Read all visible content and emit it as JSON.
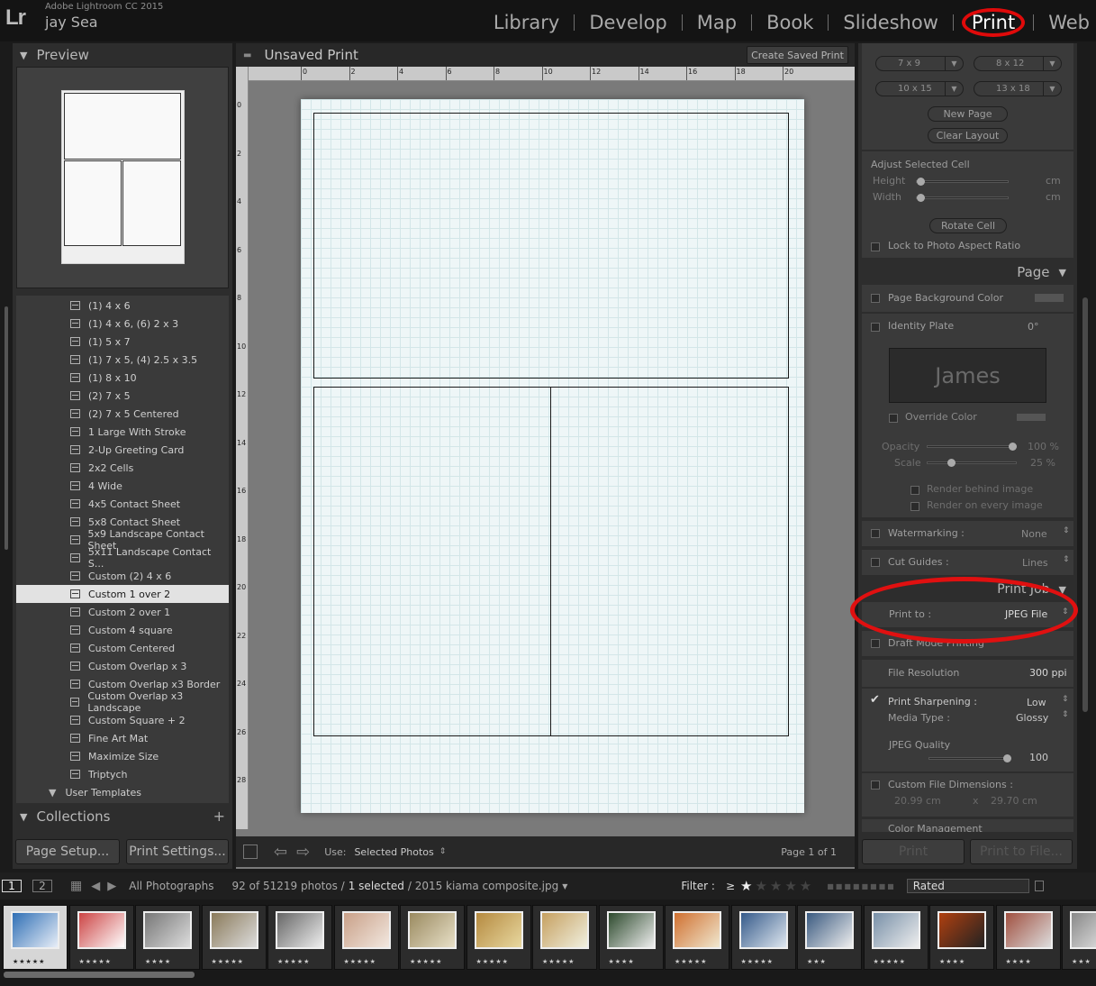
{
  "app": {
    "name": "Adobe Lightroom CC 2015",
    "user": "jay Sea",
    "logo": "Lr"
  },
  "modules": [
    "Library",
    "Develop",
    "Map",
    "Book",
    "Slideshow",
    "Print",
    "Web"
  ],
  "active_module": "Print",
  "left": {
    "preview_title": "Preview",
    "templates": [
      "(1) 4 x 6",
      "(1) 4 x 6, (6) 2 x 3",
      "(1) 5 x 7",
      "(1) 7 x 5, (4) 2.5 x 3.5",
      "(1) 8 x 10",
      "(2) 7 x 5",
      "(2) 7 x 5 Centered",
      "1 Large With Stroke",
      "2-Up Greeting Card",
      "2x2 Cells",
      "4 Wide",
      "4x5 Contact Sheet",
      "5x8 Contact Sheet",
      "5x9 Landscape Contact Sheet",
      "5x11 Landscape Contact S...",
      "Custom (2) 4 x 6",
      "Custom 1 over 2",
      "Custom 2 over 1",
      "Custom 4 square",
      "Custom Centered",
      "Custom Overlap x 3",
      "Custom Overlap x3 Border",
      "Custom Overlap x3 Landscape",
      "Custom Square + 2",
      "Fine Art Mat",
      "Maximize Size",
      "Triptych"
    ],
    "selected_template": "Custom 1 over 2",
    "user_templates": "User Templates",
    "collections": "Collections",
    "page_setup": "Page Setup...",
    "print_settings": "Print Settings..."
  },
  "center": {
    "title": "Unsaved Print",
    "create_saved": "Create Saved Print",
    "ruler_top": [
      "0",
      "2",
      "4",
      "6",
      "8",
      "10",
      "12",
      "14",
      "16",
      "18",
      "20"
    ],
    "ruler_left": [
      "0",
      "2",
      "4",
      "6",
      "8",
      "10",
      "12",
      "14",
      "16",
      "18",
      "20",
      "22",
      "24",
      "26",
      "28"
    ],
    "use_label": "Use:",
    "use_value": "Selected Photos",
    "page_info": "Page 1 of 1"
  },
  "right": {
    "sizes": [
      "7 x 9",
      "8 x 12",
      "10 x 15",
      "13 x 18"
    ],
    "new_page": "New Page",
    "clear_layout": "Clear Layout",
    "adjust_cell": "Adjust Selected Cell",
    "height": "Height",
    "width": "Width",
    "unit": "cm",
    "rotate_cell": "Rotate Cell",
    "lock_aspect": "Lock to Photo Aspect Ratio",
    "page_header": "Page",
    "page_bg": "Page Background Color",
    "identity_plate": "Identity Plate",
    "identity_angle": "0°",
    "identity_text": "James",
    "override_color": "Override Color",
    "opacity": "Opacity",
    "opacity_val": "100 %",
    "scale": "Scale",
    "scale_val": "25 %",
    "render_behind": "Render behind image",
    "render_every": "Render on every image",
    "watermarking": "Watermarking :",
    "watermarking_val": "None",
    "cut_guides": "Cut Guides :",
    "cut_guides_val": "Lines",
    "print_job_header": "Print Job",
    "print_to": "Print to :",
    "print_to_val": "JPEG File",
    "draft_mode": "Draft Mode Printing",
    "file_resolution": "File Resolution",
    "file_resolution_val": "300 ppi",
    "print_sharpening": "Print Sharpening :",
    "print_sharpening_val": "Low",
    "media_type": "Media Type :",
    "media_type_val": "Glossy",
    "jpeg_quality": "JPEG Quality",
    "jpeg_quality_val": "100",
    "custom_dims": "Custom File Dimensions :",
    "dim_w": "20.99 cm",
    "dim_x": "x",
    "dim_h": "29.70 cm",
    "color_mgmt": "Color Management",
    "print_btn": "Print",
    "print_file_btn": "Print to File..."
  },
  "filmstrip": {
    "page1": "1",
    "page2": "2",
    "source": "All Photographs",
    "count_a": "92 of 51219 photos /",
    "count_b": "1 selected",
    "count_c": "/ 2015 kiama composite.jpg",
    "filter": "Filter :",
    "filter_op": "≥",
    "rated": "Rated",
    "thumb_stars": [
      "★★★★★",
      "★★★★★",
      "★★★★",
      "★★★★★",
      "★★★★★",
      "★★★★★",
      "★★★★★",
      "★★★★★",
      "★★★★★",
      "★★★★",
      "★★★★★",
      "★★★★★",
      "★★★",
      "★★★★★",
      "★★★★",
      "★★★★",
      "★★★"
    ]
  },
  "colors": {
    "accent_red": "#e00a0a",
    "selected_row": "#e2e2e2",
    "paper": "#eef6f7"
  }
}
